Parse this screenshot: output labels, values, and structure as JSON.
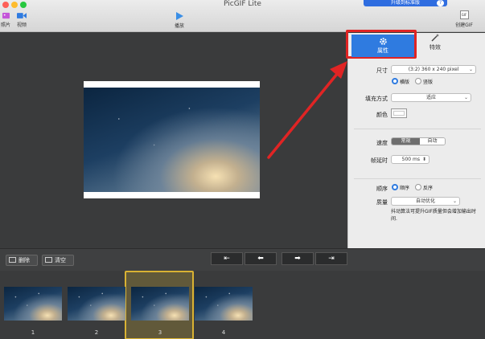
{
  "window": {
    "title": "PicGIF Lite"
  },
  "toolbar": {
    "photos_label": "照片",
    "videos_label": "视频",
    "play_label": "播放",
    "create_gif_label": "创建GIF",
    "gif_badge": "GIF",
    "upgrade_label": "升级到标准版"
  },
  "panel": {
    "tabs": [
      {
        "label": "属性"
      },
      {
        "label": "特效"
      }
    ],
    "size": {
      "label": "尺寸",
      "value": "(3:2) 360 x 240 pixel"
    },
    "orientation": {
      "landscape": "横版",
      "portrait": "竖版",
      "selected": "横版"
    },
    "fill_mode": {
      "label": "填充方式",
      "value": "适应"
    },
    "color": {
      "label": "颜色",
      "swatch": "#ffffff"
    },
    "speed": {
      "label": "速度",
      "options": [
        "常规",
        "自动"
      ],
      "selected": "常规"
    },
    "frame_delay": {
      "label": "帧延时",
      "value": "500 ms"
    },
    "order": {
      "label": "顺序",
      "forward": "顺序",
      "reverse": "反序",
      "selected": "顺序"
    },
    "quality": {
      "label": "质量",
      "value": "自动优化"
    },
    "note": "抖动算法可提升GIF质量但会增加输出时间."
  },
  "controls": {
    "delete_label": "删除",
    "clear_label": "清空"
  },
  "frames": [
    {
      "num": "1"
    },
    {
      "num": "2"
    },
    {
      "num": "3"
    },
    {
      "num": "4"
    }
  ],
  "selected_frame": "3",
  "colors": {
    "accent": "#2f7be0",
    "highlight": "#e02424",
    "selection": "#d9b233"
  }
}
